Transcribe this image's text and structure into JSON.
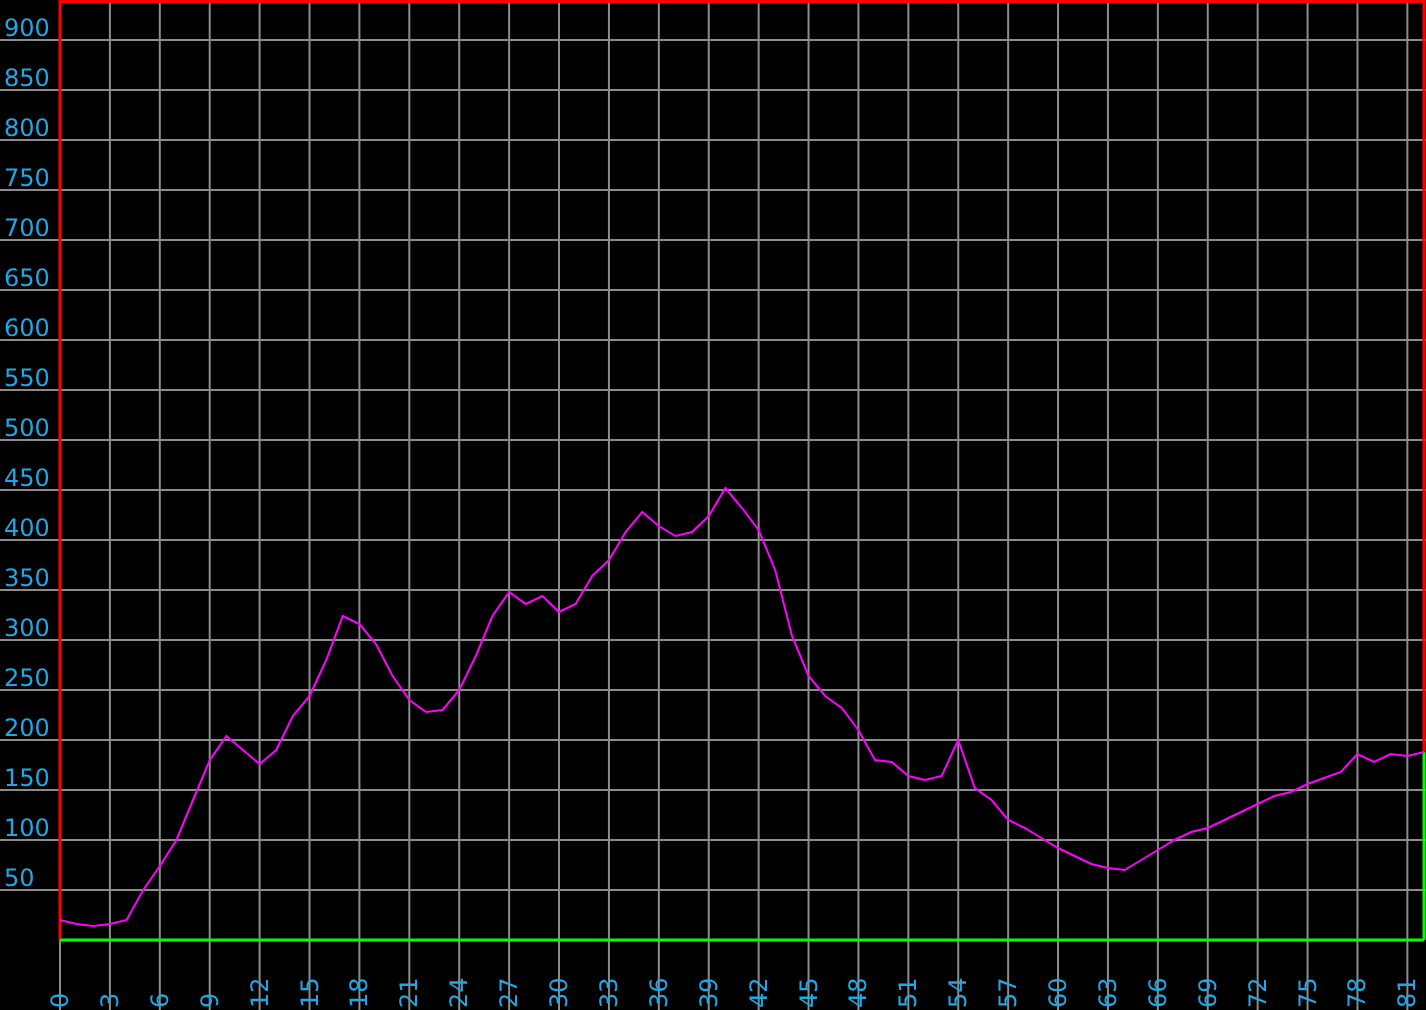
{
  "chart_data": {
    "type": "line",
    "x": [
      0,
      1,
      2,
      3,
      4,
      5,
      6,
      7,
      8,
      9,
      10,
      11,
      12,
      13,
      14,
      15,
      16,
      17,
      18,
      19,
      20,
      21,
      22,
      23,
      24,
      25,
      26,
      27,
      28,
      29,
      30,
      31,
      32,
      33,
      34,
      35,
      36,
      37,
      38,
      39,
      40,
      41,
      42,
      43,
      44,
      45,
      46,
      47,
      48,
      49,
      50,
      51,
      52,
      53,
      54,
      55,
      56,
      57,
      58,
      59,
      60,
      61,
      62,
      63,
      64,
      65,
      66,
      67,
      68,
      69,
      70,
      71,
      72,
      73,
      74,
      75,
      76,
      77,
      78,
      79,
      80,
      81,
      82
    ],
    "grid": true,
    "series": [
      {
        "color": "#ff00ff",
        "values": [
          20,
          16,
          14,
          16,
          20,
          50,
          74,
          100,
          140,
          180,
          204,
          190,
          176,
          190,
          224,
          244,
          280,
          324,
          316,
          296,
          264,
          240,
          228,
          230,
          250,
          284,
          324,
          348,
          336,
          344,
          328,
          336,
          364,
          380,
          408,
          428,
          414,
          404,
          408,
          424,
          452,
          432,
          410,
          370,
          304,
          264,
          244,
          232,
          210,
          180,
          178,
          164,
          160,
          164,
          200,
          152,
          140,
          120,
          112,
          102,
          92,
          84,
          76,
          72,
          70,
          80,
          90,
          100,
          108,
          112,
          120,
          128,
          136,
          144,
          148,
          156,
          162,
          168,
          186,
          178,
          186,
          184,
          188
        ]
      }
    ],
    "xlim": [
      0,
      82
    ],
    "ylim": [
      0,
      940
    ],
    "xticks": [
      0,
      3,
      6,
      9,
      12,
      15,
      18,
      21,
      24,
      27,
      30,
      33,
      36,
      39,
      42,
      45,
      48,
      51,
      54,
      57,
      60,
      63,
      66,
      69,
      72,
      75,
      78,
      81
    ],
    "yticks": [
      50,
      100,
      150,
      200,
      250,
      300,
      350,
      400,
      450,
      500,
      550,
      600,
      650,
      700,
      750,
      800,
      850,
      900
    ]
  }
}
